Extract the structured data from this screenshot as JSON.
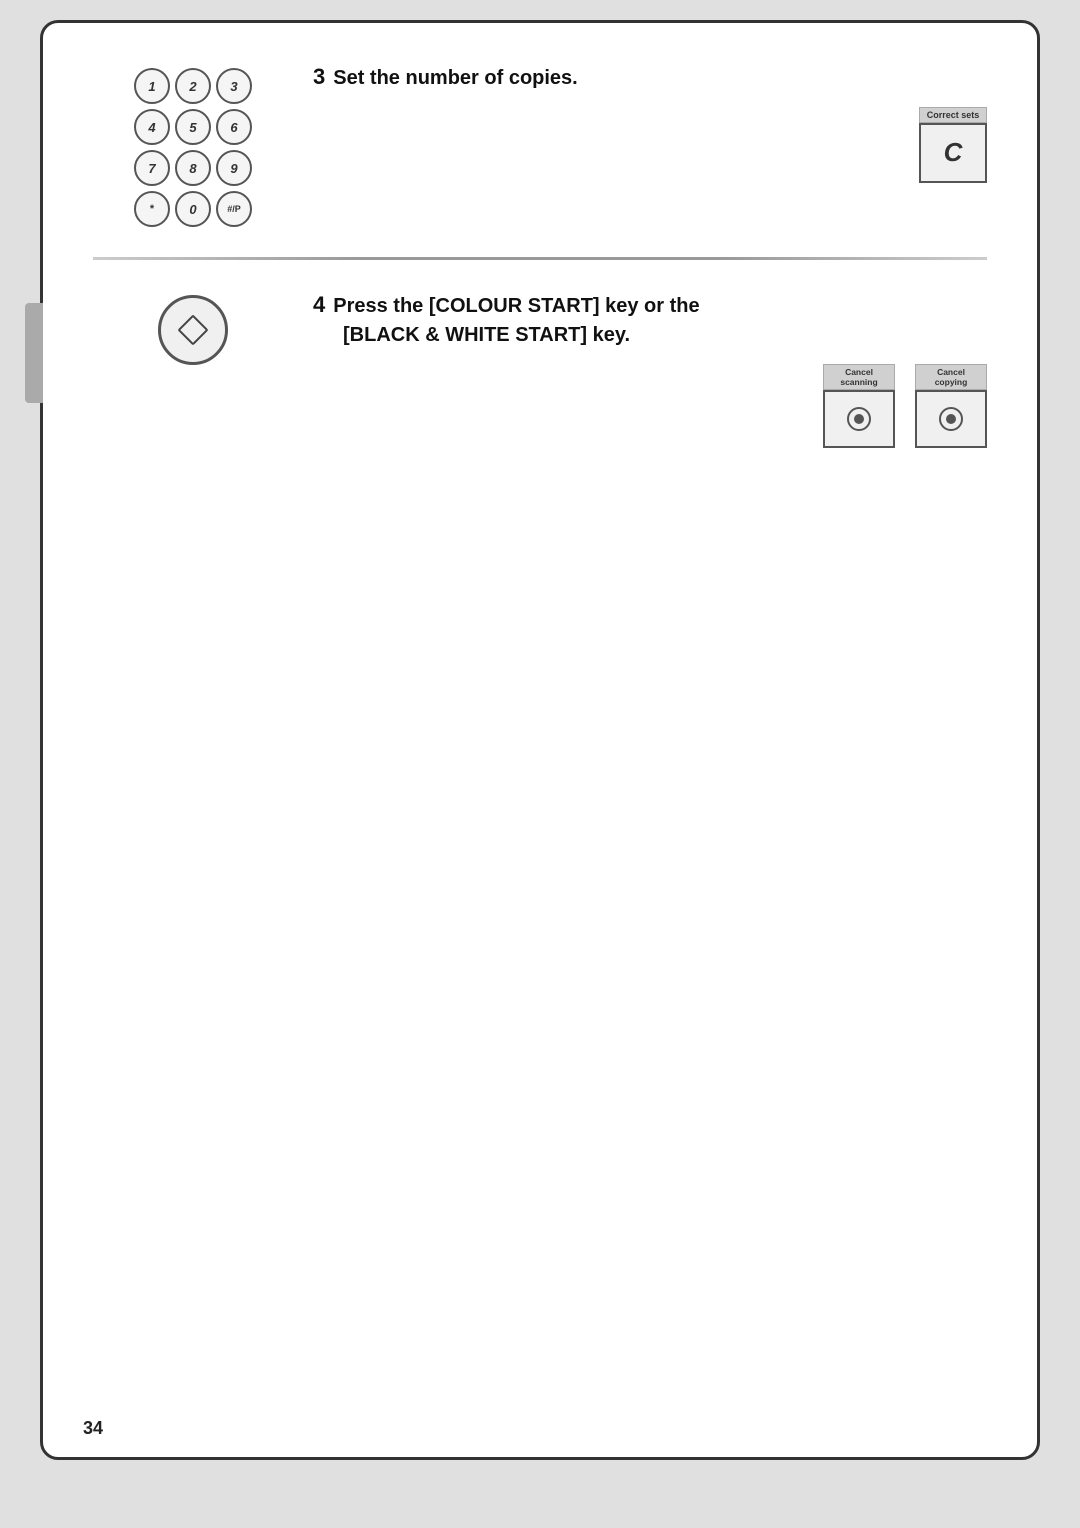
{
  "page": {
    "number": "34",
    "background": "#ffffff"
  },
  "step3": {
    "number": "3",
    "heading": "Set the number of copies.",
    "keypad": {
      "keys": [
        "1",
        "2",
        "3",
        "4",
        "5",
        "6",
        "7",
        "8",
        "9",
        "*",
        "0",
        "#/P"
      ]
    },
    "correct_sets_button": {
      "label": "Correct sets",
      "symbol": "C"
    }
  },
  "step4": {
    "number": "4",
    "heading_line1": "Press the [COLOUR START] key or the",
    "heading_line2": "[BLACK & WHITE START] key.",
    "cancel_scanning": {
      "label": "Cancel scanning"
    },
    "cancel_copying": {
      "label": "Cancel copying"
    }
  }
}
